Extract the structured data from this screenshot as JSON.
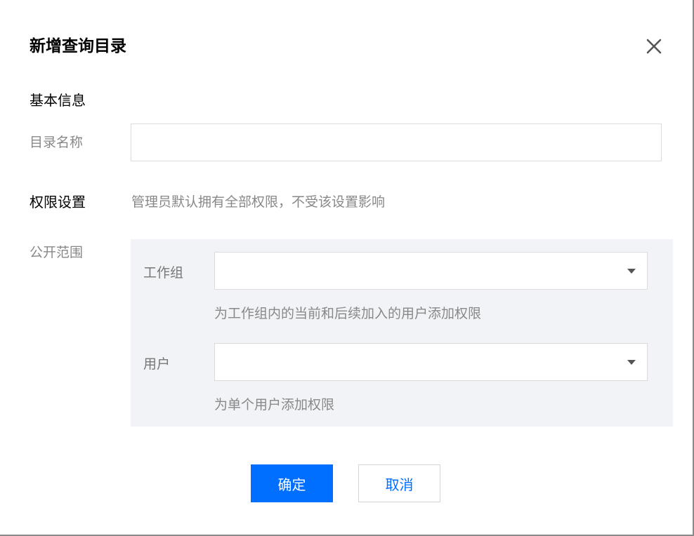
{
  "dialog": {
    "title": "新增查询目录",
    "close_icon": "close-icon"
  },
  "basic_info": {
    "section_title": "基本信息",
    "name_label": "目录名称",
    "name_value": "",
    "name_placeholder": ""
  },
  "permissions": {
    "label": "权限设置",
    "hint": "管理员默认拥有全部权限，不受该设置影响",
    "scope_label": "公开范围",
    "workgroup": {
      "label": "工作组",
      "value": "",
      "hint": "为工作组内的当前和后续加入的用户添加权限",
      "arrow_icon": "caret-down-icon"
    },
    "user": {
      "label": "用户",
      "value": "",
      "hint": "为单个用户添加权限",
      "arrow_icon": "caret-down-icon"
    }
  },
  "buttons": {
    "confirm": "确定",
    "cancel": "取消"
  },
  "colors": {
    "primary": "#006eff",
    "scope_background": "#f2f3f6",
    "muted_text": "#888888"
  }
}
